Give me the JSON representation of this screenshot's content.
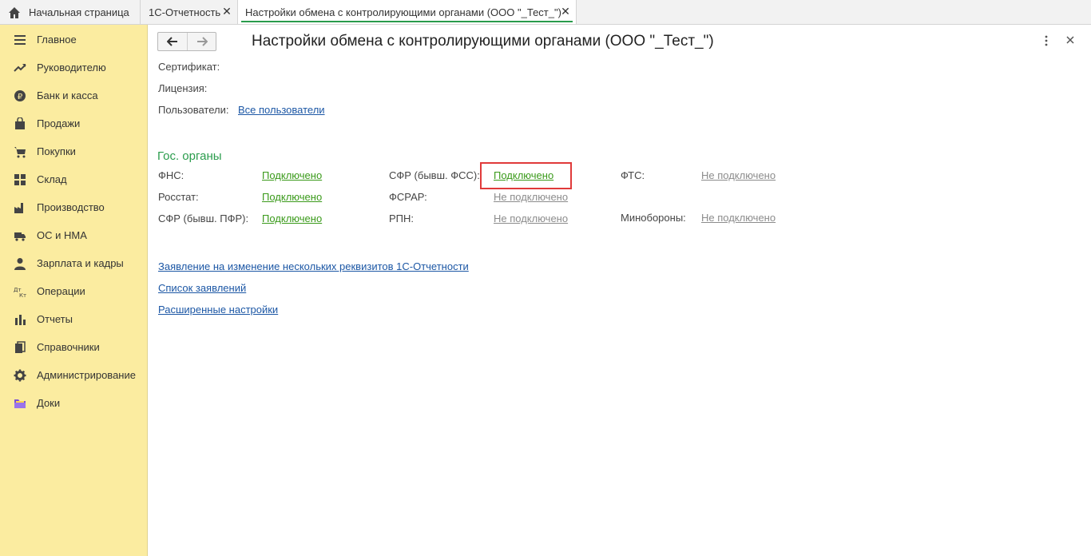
{
  "tabs": [
    {
      "label": "Начальная страница"
    },
    {
      "label": "1С-Отчетность"
    },
    {
      "label": "Настройки обмена с контролирующими органами (ООО \"_Тест_\")"
    }
  ],
  "sidebar": {
    "items": [
      {
        "label": "Главное",
        "icon": "menu-icon"
      },
      {
        "label": "Руководителю",
        "icon": "trend-icon"
      },
      {
        "label": "Банк и касса",
        "icon": "ruble-icon"
      },
      {
        "label": "Продажи",
        "icon": "bag-icon"
      },
      {
        "label": "Покупки",
        "icon": "cart-icon"
      },
      {
        "label": "Склад",
        "icon": "grid-icon"
      },
      {
        "label": "Производство",
        "icon": "factory-icon"
      },
      {
        "label": "ОС и НМА",
        "icon": "truck-icon"
      },
      {
        "label": "Зарплата и кадры",
        "icon": "person-icon"
      },
      {
        "label": "Операции",
        "icon": "dt-kt-icon"
      },
      {
        "label": "Отчеты",
        "icon": "bar-chart-icon"
      },
      {
        "label": "Справочники",
        "icon": "books-icon"
      },
      {
        "label": "Администрирование",
        "icon": "gear-icon"
      },
      {
        "label": "Доки",
        "icon": "docs-folder-icon"
      }
    ]
  },
  "header": {
    "title": "Настройки обмена с контролирующими органами (ООО \"_Тест_\")"
  },
  "form": {
    "certificate_label": "Сертификат:",
    "license_label": "Лицензия:",
    "users_label": "Пользователи:",
    "users_link": "Все пользователи"
  },
  "gov": {
    "section_title": "Гос. органы",
    "fns_label": "ФНС:",
    "fns_status": "Подключено",
    "rosstat_label": "Росстат:",
    "rosstat_status": "Подключено",
    "sfr_pfr_label": "СФР (бывш. ПФР):",
    "sfr_pfr_status": "Подключено",
    "sfr_fss_label": "СФР (бывш. ФСС):",
    "sfr_fss_status": "Подключено",
    "fsrar_label": "ФСРАР:",
    "fsrar_status": "Не подключено",
    "rpn_label": "РПН:",
    "rpn_status": "Не подключено",
    "fts_label": "ФТС:",
    "fts_status": "Не подключено",
    "minoborony_label": "Минобороны:",
    "minoborony_status": "Не подключено"
  },
  "links": {
    "change_details": "Заявление на изменение нескольких реквизитов 1С-Отчетности",
    "applications_list": "Список заявлений",
    "advanced_settings": "Расширенные настройки"
  },
  "colors": {
    "sidebar_bg": "#fbeca0",
    "accent_green": "#2a9c4c",
    "connected": "#3a9a1a",
    "not_connected": "#8c8c8c",
    "link_blue": "#1c57a5",
    "highlight_red": "#e03a3a"
  }
}
